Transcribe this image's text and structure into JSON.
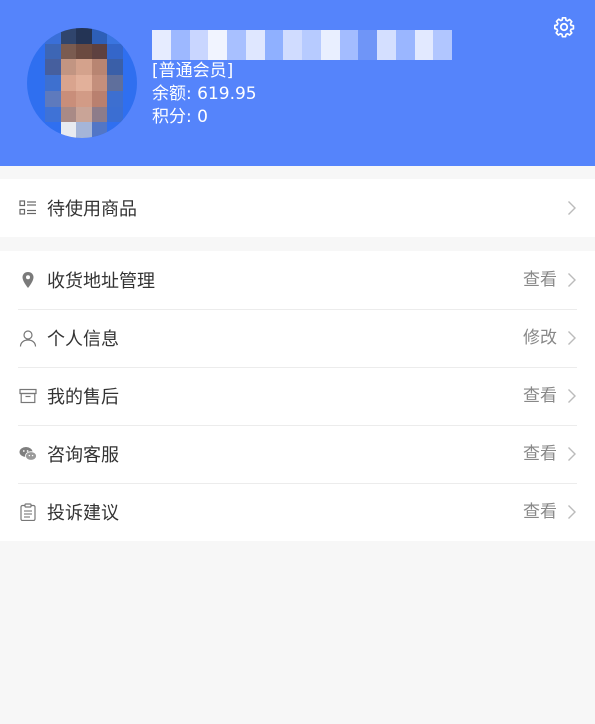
{
  "header": {
    "member_level": "[普通会员]",
    "balance_text": "余额: 619.95",
    "points_text": "积分: 0"
  },
  "icons": {
    "settings": "gear-icon",
    "pending": "list-icon",
    "address": "location-pin-icon",
    "profile": "person-icon",
    "aftersale": "archive-box-icon",
    "service": "wechat-chat-icon",
    "complaint": "clipboard-icon",
    "chevron": "chevron-right-icon"
  },
  "menu": {
    "pending_goods": {
      "label": "待使用商品"
    },
    "address": {
      "label": "收货地址管理",
      "action": "查看"
    },
    "profile": {
      "label": "个人信息",
      "action": "修改"
    },
    "aftersale": {
      "label": "我的售后",
      "action": "查看"
    },
    "service": {
      "label": "咨询客服",
      "action": "查看"
    },
    "complaint": {
      "label": "投诉建议",
      "action": "查看"
    }
  },
  "colors": {
    "header_bg": "#5584fb",
    "page_bg": "#f7f7f7"
  }
}
